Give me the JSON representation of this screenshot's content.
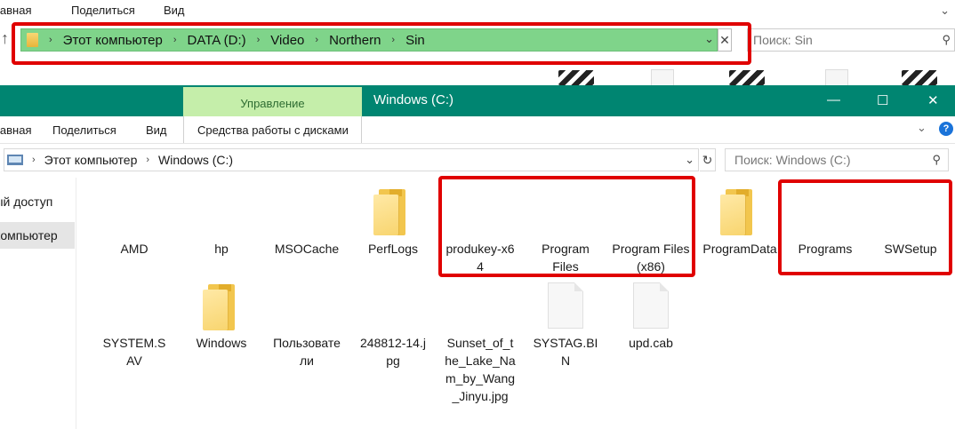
{
  "back_window": {
    "ribbon": {
      "home": "Главная",
      "share": "Поделиться",
      "view": "Вид"
    },
    "breadcrumb": [
      "Этот компьютер",
      "DATA (D:)",
      "Video",
      "Northern",
      "Sin"
    ],
    "search_placeholder": "Поиск: Sin"
  },
  "front_window": {
    "title": "Windows (C:)",
    "manage_tab": "Управление",
    "ribbon_tabs": {
      "home": "Главная",
      "share": "Поделиться",
      "view": "Вид",
      "drive_tools": "Средства работы с дисками"
    },
    "breadcrumb": [
      "Этот компьютер",
      "Windows (C:)"
    ],
    "search_placeholder": "Поиск: Windows (C:)",
    "nav": [
      "Быстрый доступ",
      "Этот компьютер"
    ],
    "items_row1": [
      "AMD",
      "hp",
      "MSOCache",
      "PerfLogs",
      "produkey-x64",
      "Program Files",
      "Program Files (x86)",
      "ProgramData",
      "Programs",
      "SWSetup"
    ],
    "items_row2": [
      "SYSTEM.SAV",
      "Windows",
      "Пользователи",
      "248812-14.jpg",
      "Sunset_of_the_Lake_Nam_by_Wang_Jinyu.jpg",
      "SYSTAG.BIN",
      "upd.cab"
    ]
  },
  "colors": {
    "title_bar": "#008571",
    "manage_tab": "#c5eeaa",
    "address_highlight": "#7fd48a",
    "annotation_red": "#e00000"
  }
}
